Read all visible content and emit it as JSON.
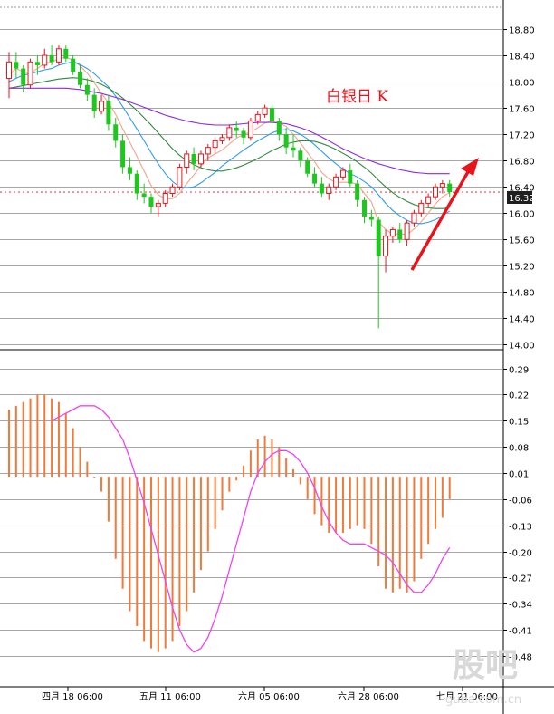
{
  "title": "白银日 K",
  "current_price": "16.32",
  "watermark": {
    "logo": "股吧",
    "site": "guba.com.cn"
  },
  "colors": {
    "up": "#e8141b",
    "down": "#1bc81b",
    "ma5": "#f4a48a",
    "ma10": "#2d9cf0",
    "ma20": "#2e8b3c",
    "ma60": "#8a2be2",
    "macd_hist": "#f07a3a",
    "macd_signal": "#ee44ee",
    "arrow": "#e8141b",
    "price_box": "#1f1f1f"
  },
  "chart_data": [
    {
      "type": "candlestick",
      "title": "白银日 K",
      "ylim": [
        14.0,
        18.95
      ],
      "y_ticks": [
        "18.80",
        "18.40",
        "18.00",
        "17.60",
        "17.20",
        "16.80",
        "16.40",
        "16.00",
        "15.60",
        "15.20",
        "14.80",
        "14.40",
        "14.00"
      ],
      "x_ticks": [
        "四月 18 06:00",
        "五月 11 06:00",
        "六月 05 06:00",
        "六月 28 06:00",
        "七月 21 06:00"
      ],
      "ohlc": [
        [
          18.05,
          18.45,
          17.75,
          18.3
        ],
        [
          18.3,
          18.45,
          18.05,
          18.2
        ],
        [
          18.2,
          18.25,
          17.85,
          17.95
        ],
        [
          17.95,
          18.35,
          17.9,
          18.3
        ],
        [
          18.3,
          18.4,
          18.1,
          18.25
        ],
        [
          18.25,
          18.5,
          18.2,
          18.4
        ],
        [
          18.4,
          18.55,
          18.25,
          18.3
        ],
        [
          18.3,
          18.55,
          18.25,
          18.5
        ],
        [
          18.5,
          18.55,
          18.3,
          18.35
        ],
        [
          18.35,
          18.4,
          18.1,
          18.15
        ],
        [
          18.15,
          18.25,
          17.9,
          17.95
        ],
        [
          17.95,
          18.05,
          17.7,
          17.8
        ],
        [
          17.8,
          17.9,
          17.45,
          17.55
        ],
        [
          17.55,
          17.8,
          17.5,
          17.7
        ],
        [
          17.7,
          17.8,
          17.25,
          17.35
        ],
        [
          17.35,
          17.45,
          17.0,
          17.1
        ],
        [
          17.1,
          17.2,
          16.6,
          16.7
        ],
        [
          16.7,
          16.85,
          16.5,
          16.6
        ],
        [
          16.6,
          16.65,
          16.2,
          16.3
        ],
        [
          16.3,
          16.45,
          16.15,
          16.25
        ],
        [
          16.25,
          16.3,
          16.0,
          16.1
        ],
        [
          16.1,
          16.2,
          15.95,
          16.15
        ],
        [
          16.15,
          16.35,
          16.1,
          16.3
        ],
        [
          16.3,
          16.45,
          16.25,
          16.4
        ],
        [
          16.4,
          16.75,
          16.35,
          16.7
        ],
        [
          16.7,
          16.95,
          16.6,
          16.9
        ],
        [
          16.9,
          17.0,
          16.65,
          16.75
        ],
        [
          16.75,
          16.95,
          16.7,
          16.9
        ],
        [
          16.9,
          17.05,
          16.8,
          17.0
        ],
        [
          17.0,
          17.15,
          16.9,
          17.1
        ],
        [
          17.1,
          17.2,
          17.05,
          17.15
        ],
        [
          17.15,
          17.35,
          17.1,
          17.3
        ],
        [
          17.3,
          17.4,
          17.15,
          17.25
        ],
        [
          17.25,
          17.3,
          17.05,
          17.15
        ],
        [
          17.15,
          17.45,
          17.1,
          17.4
        ],
        [
          17.4,
          17.55,
          17.35,
          17.5
        ],
        [
          17.5,
          17.65,
          17.45,
          17.6
        ],
        [
          17.6,
          17.65,
          17.35,
          17.4
        ],
        [
          17.4,
          17.45,
          17.1,
          17.2
        ],
        [
          17.2,
          17.3,
          16.9,
          17.0
        ],
        [
          17.0,
          17.2,
          16.85,
          16.95
        ],
        [
          16.95,
          17.0,
          16.7,
          16.8
        ],
        [
          16.8,
          16.85,
          16.55,
          16.6
        ],
        [
          16.6,
          16.7,
          16.4,
          16.45
        ],
        [
          16.45,
          16.55,
          16.25,
          16.3
        ],
        [
          16.3,
          16.45,
          16.2,
          16.4
        ],
        [
          16.4,
          16.6,
          16.35,
          16.55
        ],
        [
          16.55,
          16.7,
          16.5,
          16.65
        ],
        [
          16.65,
          16.75,
          16.4,
          16.45
        ],
        [
          16.45,
          16.5,
          16.1,
          16.2
        ],
        [
          16.2,
          16.25,
          15.85,
          15.95
        ],
        [
          15.95,
          16.05,
          15.8,
          15.9
        ],
        [
          15.9,
          15.95,
          14.25,
          15.35
        ],
        [
          15.35,
          15.75,
          15.1,
          15.65
        ],
        [
          15.65,
          15.8,
          15.55,
          15.75
        ],
        [
          15.75,
          15.85,
          15.55,
          15.6
        ],
        [
          15.6,
          15.9,
          15.5,
          15.85
        ],
        [
          15.85,
          16.05,
          15.8,
          16.0
        ],
        [
          16.0,
          16.2,
          15.95,
          16.15
        ],
        [
          16.15,
          16.3,
          16.1,
          16.25
        ],
        [
          16.25,
          16.45,
          16.2,
          16.4
        ],
        [
          16.4,
          16.5,
          16.3,
          16.45
        ],
        [
          16.45,
          16.5,
          16.25,
          16.32
        ]
      ],
      "series": [
        {
          "type": "line",
          "values": [
            18.1,
            18.2,
            18.15,
            18.13,
            18.2,
            18.28,
            18.3,
            18.35,
            18.37,
            18.33,
            18.24,
            18.13,
            17.98,
            17.82,
            17.68,
            17.5,
            17.28,
            17.08,
            16.86,
            16.64,
            16.42,
            16.28,
            16.22,
            16.22,
            16.3,
            16.45,
            16.58,
            16.72,
            16.84,
            16.9,
            16.96,
            17.05,
            17.14,
            17.2,
            17.23,
            17.3,
            17.37,
            17.4,
            17.37,
            17.32,
            17.2,
            17.07,
            16.92,
            16.78,
            16.62,
            16.52,
            16.47,
            16.47,
            16.47,
            16.44,
            16.3,
            16.17,
            15.87,
            15.75,
            15.68,
            15.69,
            15.67,
            15.76,
            15.87,
            16.0,
            16.14,
            16.25,
            16.31
          ]
        },
        {
          "type": "line",
          "values": [
            18.0,
            18.05,
            18.1,
            18.12,
            18.15,
            18.18,
            18.2,
            18.25,
            18.28,
            18.3,
            18.26,
            18.2,
            18.12,
            18.02,
            17.92,
            17.78,
            17.62,
            17.45,
            17.28,
            17.1,
            16.92,
            16.75,
            16.6,
            16.48,
            16.4,
            16.38,
            16.4,
            16.46,
            16.54,
            16.62,
            16.72,
            16.8,
            16.88,
            16.96,
            17.03,
            17.1,
            17.16,
            17.22,
            17.26,
            17.27,
            17.25,
            17.2,
            17.13,
            17.04,
            16.94,
            16.84,
            16.75,
            16.67,
            16.6,
            16.55,
            16.48,
            16.4,
            16.28,
            16.15,
            16.04,
            15.96,
            15.89,
            15.85,
            15.84,
            15.86,
            15.9,
            15.96,
            16.03
          ]
        },
        {
          "type": "line",
          "values": [
            17.9,
            17.92,
            17.94,
            17.96,
            17.98,
            18.0,
            18.02,
            18.04,
            18.05,
            18.06,
            18.05,
            18.03,
            18.0,
            17.96,
            17.9,
            17.83,
            17.75,
            17.66,
            17.56,
            17.45,
            17.34,
            17.22,
            17.1,
            16.98,
            16.88,
            16.8,
            16.74,
            16.69,
            16.66,
            16.64,
            16.64,
            16.66,
            16.69,
            16.73,
            16.78,
            16.83,
            16.89,
            16.95,
            17.0,
            17.05,
            17.08,
            17.1,
            17.1,
            17.09,
            17.06,
            17.02,
            16.97,
            16.91,
            16.85,
            16.78,
            16.7,
            16.61,
            16.5,
            16.4,
            16.31,
            16.24,
            16.18,
            16.13,
            16.1,
            16.08,
            16.07,
            16.07,
            16.08
          ]
        },
        {
          "type": "line",
          "values": [
            17.9,
            17.9,
            17.9,
            17.9,
            17.9,
            17.9,
            17.9,
            17.9,
            17.9,
            17.89,
            17.88,
            17.86,
            17.84,
            17.82,
            17.79,
            17.76,
            17.73,
            17.69,
            17.65,
            17.61,
            17.57,
            17.53,
            17.49,
            17.46,
            17.43,
            17.4,
            17.38,
            17.36,
            17.35,
            17.34,
            17.34,
            17.34,
            17.35,
            17.36,
            17.37,
            17.38,
            17.38,
            17.38,
            17.37,
            17.36,
            17.33,
            17.3,
            17.26,
            17.21,
            17.16,
            17.1,
            17.04,
            16.98,
            16.93,
            16.88,
            16.83,
            16.79,
            16.75,
            16.72,
            16.69,
            16.66,
            16.64,
            16.62,
            16.61,
            16.6,
            16.6,
            16.6,
            16.6
          ]
        }
      ]
    },
    {
      "type": "bar",
      "ylim": [
        -0.52,
        0.33
      ],
      "y_ticks": [
        "0.29",
        "0.22",
        "0.15",
        "0.08",
        "0.01",
        "-0.06",
        "-0.13",
        "-0.20",
        "-0.27",
        "-0.34",
        "-0.41",
        "-0.48"
      ],
      "values": [
        0.18,
        0.19,
        0.2,
        0.21,
        0.22,
        0.22,
        0.21,
        0.2,
        0.17,
        0.13,
        0.08,
        0.04,
        0.0,
        -0.04,
        -0.12,
        -0.22,
        -0.3,
        -0.36,
        -0.4,
        -0.44,
        -0.46,
        -0.47,
        -0.46,
        -0.44,
        -0.4,
        -0.36,
        -0.31,
        -0.25,
        -0.2,
        -0.14,
        -0.09,
        -0.04,
        -0.01,
        0.03,
        0.07,
        0.1,
        0.11,
        0.1,
        0.08,
        0.05,
        0.02,
        -0.02,
        -0.06,
        -0.1,
        -0.13,
        -0.15,
        -0.15,
        -0.15,
        -0.14,
        -0.13,
        -0.14,
        -0.18,
        -0.24,
        -0.3,
        -0.31,
        -0.3,
        -0.31,
        -0.28,
        -0.22,
        -0.18,
        -0.14,
        -0.11,
        -0.06
      ],
      "series": [
        {
          "type": "line",
          "values": [
            0.15,
            0.16,
            0.17,
            0.18,
            0.19,
            0.19,
            0.19,
            0.18,
            0.16,
            0.13,
            0.1,
            0.05,
            -0.01,
            -0.07,
            -0.14,
            -0.21,
            -0.28,
            -0.35,
            -0.41,
            -0.45,
            -0.47,
            -0.46,
            -0.43,
            -0.38,
            -0.32,
            -0.25,
            -0.18,
            -0.11,
            -0.04,
            0.01,
            0.04,
            0.06,
            0.07,
            0.07,
            0.06,
            0.04,
            0.01,
            -0.03,
            -0.08,
            -0.12,
            -0.15,
            -0.17,
            -0.18,
            -0.18,
            -0.18,
            -0.19,
            -0.2,
            -0.21,
            -0.23,
            -0.26,
            -0.29,
            -0.31,
            -0.31,
            -0.29,
            -0.26,
            -0.22,
            -0.19
          ]
        }
      ]
    }
  ]
}
